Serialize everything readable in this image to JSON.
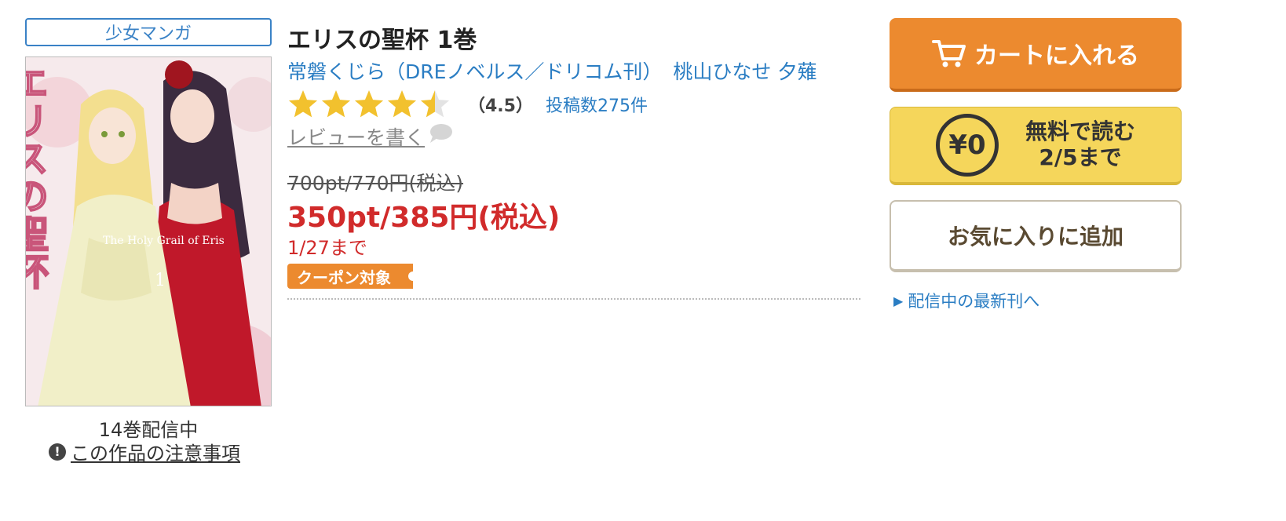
{
  "genre": "少女マンガ",
  "title": "エリスの聖杯 1巻",
  "authors": [
    "常磐くじら（DREノベルス／ドリコム刊）",
    "桃山ひなせ",
    "夕薙"
  ],
  "cover": {
    "title_text": "エリスの聖杯",
    "subtitle": "The Holy Grail of Eris",
    "volume": "1"
  },
  "volume_count": "14巻配信中",
  "notice_icon": "!",
  "notice_link": "この作品の注意事項",
  "rating": {
    "score": 4.5,
    "max": 5,
    "label": "（4.5）",
    "posts": "投稿数275件"
  },
  "review_link": "レビューを書く",
  "price": {
    "original": "700pt/770円(税込)",
    "sale": "350pt/385円(税込)",
    "until": "1/27まで"
  },
  "coupon_label": "クーポン対象",
  "buttons": {
    "cart": "カートに入れる",
    "free_symbol": "¥0",
    "free_line1": "無料で読む",
    "free_line2": "2/5まで",
    "favorite": "お気に入りに追加"
  },
  "latest_link": "配信中の最新刊へ",
  "colors": {
    "accent_blue": "#2a7dc3",
    "cart_orange": "#ec8a2f",
    "free_yellow": "#f5d65b",
    "price_red": "#d12b2b",
    "star_yellow": "#f2c12e"
  }
}
